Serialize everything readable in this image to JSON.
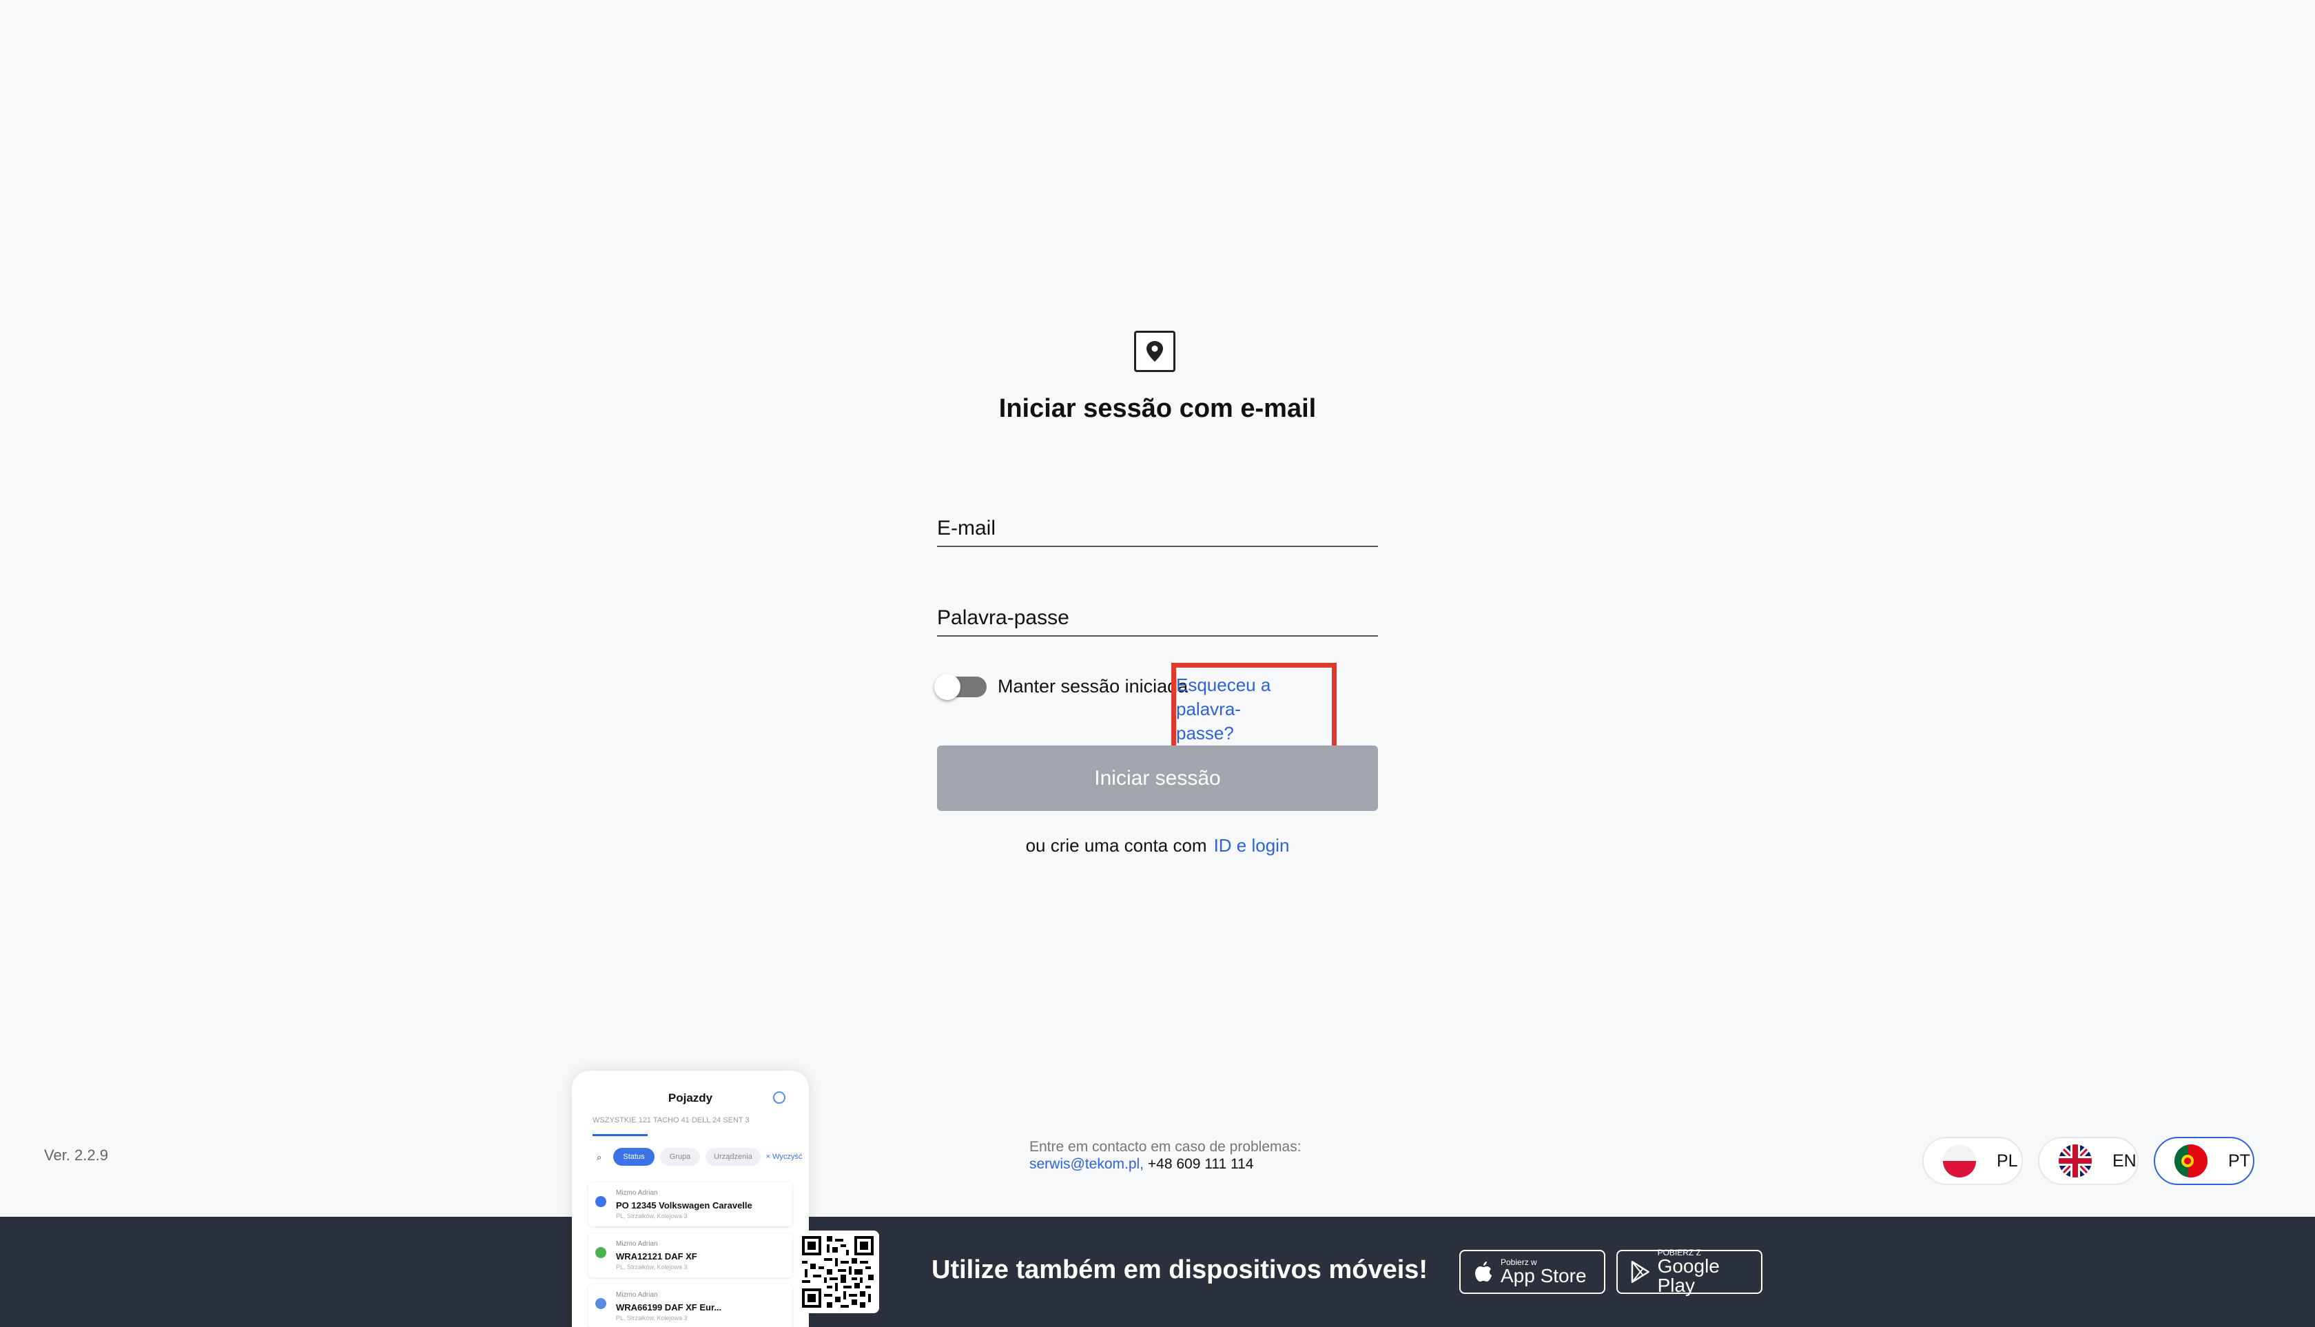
{
  "login": {
    "title": "Iniciar sessão com e-mail",
    "email_placeholder": "E-mail",
    "password_placeholder": "Palavra-passe",
    "remember_label": "Manter sessão iniciada",
    "forgot_line1": "Esqueceu a palavra-",
    "forgot_line2": "passe?",
    "submit_label": "Iniciar sessão",
    "create_text": "ou crie uma conta com",
    "create_link": "ID e login"
  },
  "footer": {
    "version": "Ver. 2.2.9",
    "contact_label": "Entre em contacto em caso de problemas:",
    "contact_email": "serwis@tekom.pl,",
    "contact_phone": "+48 609 111 114",
    "mobile_text": "Utilize também em dispositivos móveis!",
    "appstore_small": "Pobierz w",
    "appstore_big": "App Store",
    "googleplay_small": "POBIERZ Z",
    "googleplay_big": "Google Play"
  },
  "languages": [
    {
      "code": "PL",
      "active": false
    },
    {
      "code": "EN",
      "active": false
    },
    {
      "code": "PT",
      "active": true
    }
  ],
  "phone_preview": {
    "title": "Pojazdy",
    "tabs": "WSZYSTKIE 121   TACHO 41   DELL 24   SENT 3",
    "chips": [
      "Status",
      "Grupa",
      "Urządzenia",
      "× Wyczyść"
    ],
    "items": [
      {
        "owner": "Mizmo Adrian",
        "name": "PO 12345 Volkswagen Caravelle",
        "addr": "PL, Strzałków, Kolejowa 3"
      },
      {
        "owner": "Mizmo Adrian",
        "name": "WRA12121 DAF XF",
        "addr": "PL, Strzałków, Kolejowa 3"
      },
      {
        "owner": "Mizmo Adrian",
        "name": "WRA66199 DAF XF Eur...",
        "addr": "PL, Strzałków, Kolejowa 3"
      }
    ]
  },
  "colors": {
    "accent": "#2d63d8",
    "highlight": "#e03a2a",
    "footer_bg": "#2b313c",
    "button_disabled": "#a2a6ac"
  }
}
